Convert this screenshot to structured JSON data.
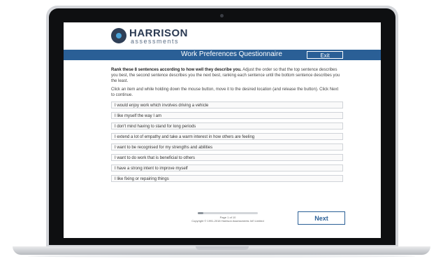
{
  "brand": {
    "name": "HARRISON",
    "sub": "assessments"
  },
  "header": {
    "title": "Work Preferences Questionnaire",
    "exit_label": "Exit"
  },
  "instructions": {
    "lead_bold": "Rank these 8 sentences according to how well they describe you.",
    "lead_rest": " Adjust the order so that the top sentence describes you best, the second sentence describes you the next best, ranking each sentence until the bottom sentence describes you the least.",
    "second": "Click an item and while holding down the mouse button, move it to the desired location (and release the button). Click Next to continue."
  },
  "items": [
    "I would enjoy work which involves driving a vehicle",
    "I like myself the way I am",
    "I don't mind having to stand for long periods",
    "I extend a lot of empathy and take a warm interest in how others are feeling",
    "I want to be recognised for my strengths and abilities",
    "I want to do work that is beneficial to others",
    "I have a strong intent to improve myself",
    "I like fixing or repairing things"
  ],
  "footer": {
    "page_indicator": "Page 1 of 10",
    "progress_fraction": 0.09,
    "copyright": "Copyright © 1991-2018 Harrison Assessments Int'l Limited",
    "next_label": "Next"
  },
  "colors": {
    "accent": "#2a5f96",
    "logo_dark": "#2b3a52",
    "logo_dot": "#4aa3d8"
  }
}
